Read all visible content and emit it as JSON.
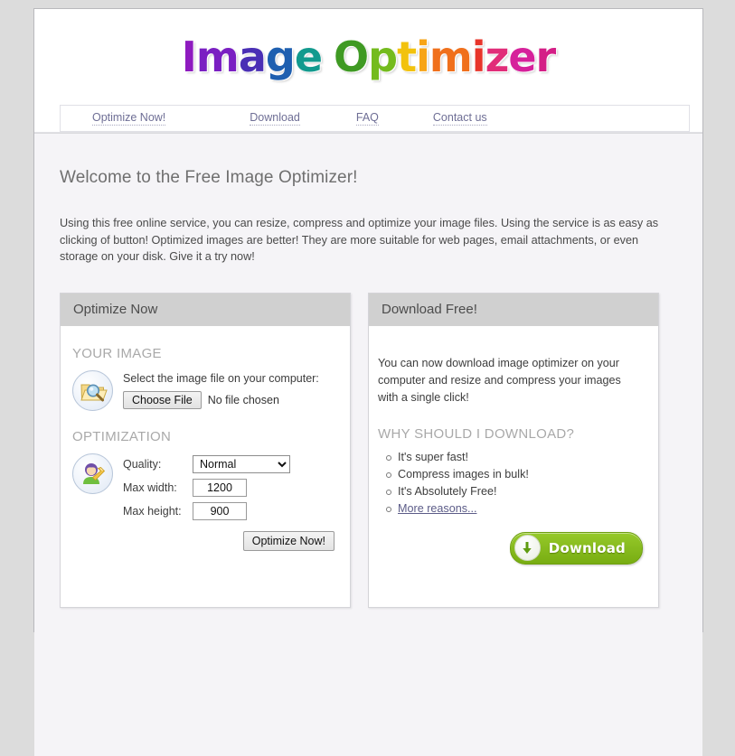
{
  "site": {
    "logo_word_1": "Image",
    "logo_word_2": "Optimizer",
    "logo_letters_1": [
      {
        "ch": "I",
        "color": "#8e1bbf"
      },
      {
        "ch": "m",
        "color": "#7a1fc2"
      },
      {
        "ch": "a",
        "color": "#4a2fb5"
      },
      {
        "ch": "g",
        "color": "#1e5fb0"
      },
      {
        "ch": "e",
        "color": "#129a8e"
      }
    ],
    "logo_letters_2": [
      {
        "ch": "O",
        "color": "#3f9a23"
      },
      {
        "ch": "p",
        "color": "#74bb1e"
      },
      {
        "ch": "t",
        "color": "#f2c20d"
      },
      {
        "ch": "i",
        "color": "#f7a416"
      },
      {
        "ch": "m",
        "color": "#f0701c"
      },
      {
        "ch": "i",
        "color": "#e8352b"
      },
      {
        "ch": "z",
        "color": "#e12d79"
      },
      {
        "ch": "e",
        "color": "#d6219b"
      },
      {
        "ch": "r",
        "color": "#d41e86"
      }
    ]
  },
  "nav": {
    "items": [
      {
        "label": "Optimize Now!",
        "name": "nav-optimize-now"
      },
      {
        "label": "Download",
        "name": "nav-download"
      },
      {
        "label": "FAQ",
        "name": "nav-faq"
      },
      {
        "label": "Contact us",
        "name": "nav-contact-us"
      }
    ]
  },
  "main": {
    "heading": "Welcome to the Free Image Optimizer!",
    "intro": "Using this free online service, you can resize, compress and optimize your image files. Using the service is as easy as clicking of button! Optimized images are better! They are more suitable for web pages, email attachments, or even storage on your disk. Give it a try now!"
  },
  "optimize_panel": {
    "header": "Optimize Now",
    "your_image_title": "YOUR IMAGE",
    "select_caption": "Select the image file on your computer:",
    "choose_file_label": "Choose File",
    "no_file_text": "No file chosen",
    "optimization_title": "OPTIMIZATION",
    "quality_label": "Quality:",
    "quality_value": "Normal",
    "quality_options": [
      "Normal"
    ],
    "max_width_label": "Max width:",
    "max_width_value": "1200",
    "max_height_label": "Max height:",
    "max_height_value": "900",
    "optimize_button_label": "Optimize Now!"
  },
  "download_panel": {
    "header": "Download Free!",
    "description": "You can now download image optimizer on your computer and resize and compress your images with a single click!",
    "why_title": "WHY SHOULD I DOWNLOAD?",
    "reasons": [
      "It's super fast!",
      "Compress images in bulk!",
      "It's Absolutely Free!"
    ],
    "more_reasons_label": "More reasons...",
    "download_button_label": "Download"
  },
  "colors": {
    "page_bg": "#dcdcdc",
    "body_bg": "#f5f4f7",
    "panel_header_bg": "#d0d0d0",
    "link": "#6e6e95",
    "download_green": "#8fc320"
  }
}
